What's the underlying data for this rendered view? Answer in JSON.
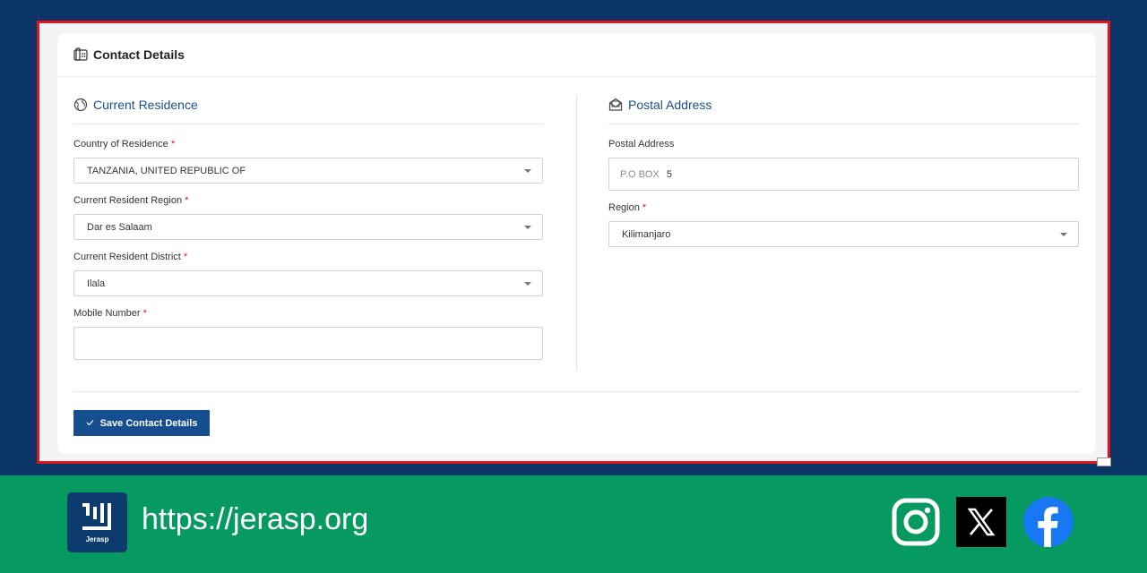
{
  "card": {
    "title": "Contact Details"
  },
  "current_residence": {
    "title": "Current Residence",
    "country": {
      "label": "Country of Residence",
      "required": "*",
      "value": "TANZANIA, UNITED REPUBLIC OF"
    },
    "region": {
      "label": "Current Resident Region",
      "required": "*",
      "value": "Dar es Salaam"
    },
    "district": {
      "label": "Current Resident District",
      "required": "*",
      "value": "Ilala"
    },
    "mobile": {
      "label": "Mobile Number",
      "required": "*",
      "value": ""
    }
  },
  "postal_address": {
    "title": "Postal Address",
    "postal": {
      "label": "Postal Address",
      "prefix": "P.O BOX",
      "value": "5"
    },
    "region": {
      "label": "Region",
      "required": "*",
      "value": "Kilimanjaro"
    }
  },
  "actions": {
    "save_label": "Save Contact Details",
    "save_icon": "check-icon"
  },
  "footer": {
    "logo_text": "Jerasp",
    "url": "https://jerasp.org",
    "social": [
      "instagram-icon",
      "x-icon",
      "facebook-icon"
    ]
  },
  "colors": {
    "background": "#0b3566",
    "frame_border": "#e3141b",
    "accent": "#164e8f",
    "section_title": "#1a4f8b",
    "footer": "#069a62",
    "required": "#e3141b"
  }
}
